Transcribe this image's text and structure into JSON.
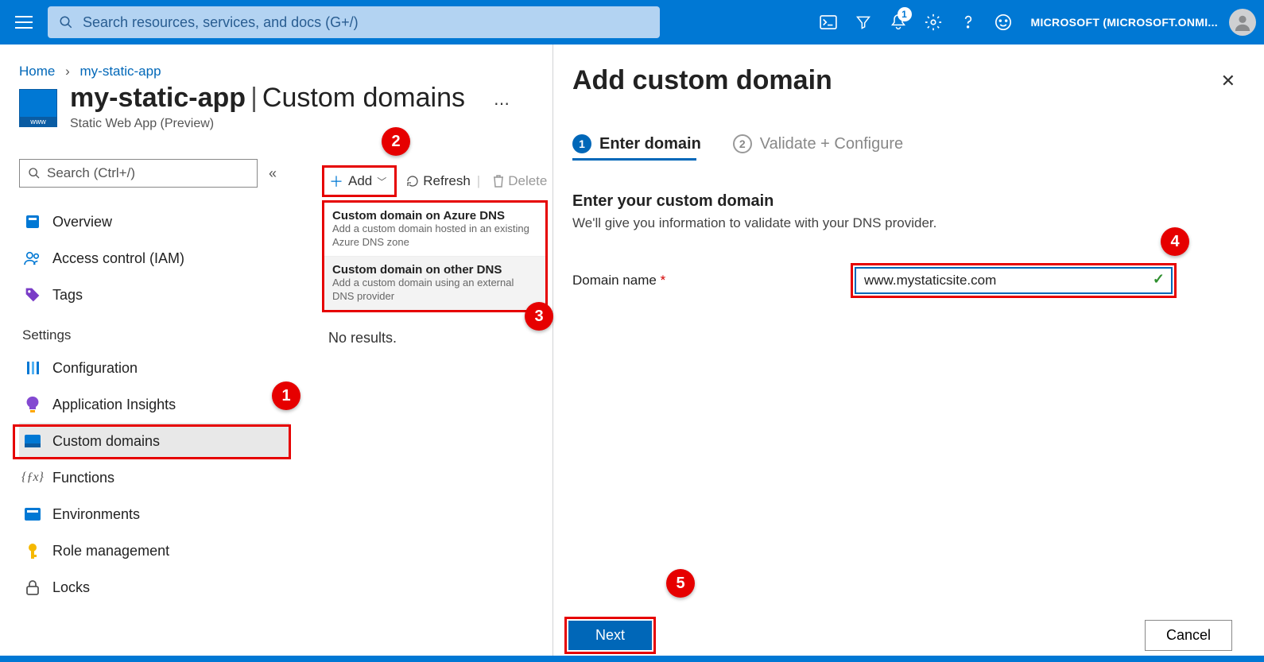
{
  "topbar": {
    "search_placeholder": "Search resources, services, and docs (G+/)",
    "notification_count": "1",
    "account_label": "MICROSOFT (MICROSOFT.ONMI..."
  },
  "breadcrumb": {
    "item1": "Home",
    "item2": "my-static-app"
  },
  "header": {
    "app_name": "my-static-app",
    "separator": "|",
    "section": "Custom domains",
    "subtitle": "Static Web App (Preview)"
  },
  "menu_search_placeholder": "Search (Ctrl+/)",
  "menu": {
    "overview": "Overview",
    "access_control": "Access control (IAM)",
    "tags": "Tags",
    "settings_label": "Settings",
    "configuration": "Configuration",
    "app_insights": "Application Insights",
    "custom_domains": "Custom domains",
    "functions": "Functions",
    "environments": "Environments",
    "role_management": "Role management",
    "locks": "Locks"
  },
  "toolbar": {
    "add": "Add",
    "refresh": "Refresh",
    "delete": "Delete"
  },
  "dropdown": {
    "opt1_title": "Custom domain on Azure DNS",
    "opt1_sub": "Add a custom domain hosted in an existing Azure DNS zone",
    "opt2_title": "Custom domain on other DNS",
    "opt2_sub": "Add a custom domain using an external DNS provider"
  },
  "no_results": "No results.",
  "panel": {
    "title": "Add custom domain",
    "step1": "Enter domain",
    "step2": "Validate + Configure",
    "form_heading": "Enter your custom domain",
    "form_sub": "We'll give you information to validate with your DNS provider.",
    "domain_label": "Domain name",
    "domain_value": "www.mystaticsite.com",
    "next": "Next",
    "cancel": "Cancel"
  },
  "callouts": {
    "c1": "1",
    "c2": "2",
    "c3": "3",
    "c4": "4",
    "c5": "5"
  }
}
